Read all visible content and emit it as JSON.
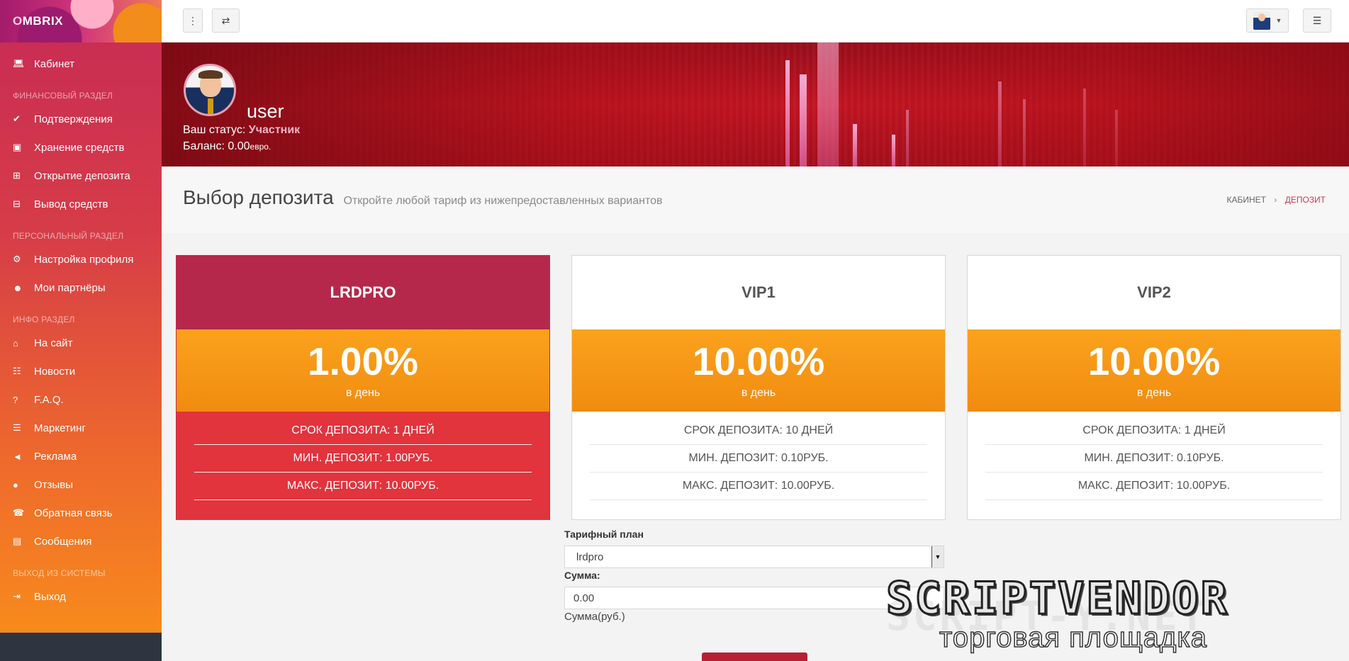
{
  "brand": {
    "first_letter": "O",
    "rest": "MBRIX"
  },
  "sidebar": {
    "cabinet": {
      "label": "Кабинет",
      "icon": "laptop-icon"
    },
    "sections": [
      {
        "title": "ФИНАНСОВЫЙ РАЗДЕЛ",
        "items": [
          {
            "label": "Подтверждения",
            "icon": "check-circle-icon"
          },
          {
            "label": "Хранение средств",
            "icon": "briefcase-icon"
          },
          {
            "label": "Открытие депозита",
            "icon": "plus-square-icon"
          },
          {
            "label": "Вывод средств",
            "icon": "minus-square-icon"
          }
        ]
      },
      {
        "title": "ПЕРСОНАЛЬНЫЙ РАЗДЕЛ",
        "items": [
          {
            "label": "Настройка профиля",
            "icon": "gears-icon"
          },
          {
            "label": "Мои партнёры",
            "icon": "users-icon"
          }
        ]
      },
      {
        "title": "ИНФО РАЗДЕЛ",
        "items": [
          {
            "label": "На сайт",
            "icon": "home-icon"
          },
          {
            "label": "Новости",
            "icon": "newspaper-icon"
          },
          {
            "label": "F.A.Q.",
            "icon": "question-circle-icon"
          },
          {
            "label": "Маркетинг",
            "icon": "book-icon"
          },
          {
            "label": "Реклама",
            "icon": "bullhorn-icon"
          },
          {
            "label": "Отзывы",
            "icon": "comment-icon"
          },
          {
            "label": "Обратная связь",
            "icon": "phone-icon"
          },
          {
            "label": "Сообщения",
            "icon": "inbox-icon"
          }
        ]
      },
      {
        "title": "ВЫХОД ИЗ СИСТЕМЫ",
        "items": [
          {
            "label": "Выход",
            "icon": "sign-out-icon"
          }
        ]
      }
    ]
  },
  "profile": {
    "username": "user",
    "status_label": "Ваш статус:",
    "status_value": "Участник",
    "balance_label": "Баланс:",
    "balance_value": "0.00",
    "balance_unit": "евро."
  },
  "page": {
    "title": "Выбор депозита",
    "subtitle": "Откройте любой тариф из нижепредоставленных вариантов",
    "breadcrumb": [
      "КАБИНЕТ",
      "ДЕПОЗИТ"
    ]
  },
  "plans": [
    {
      "name": "LRDPRO",
      "rate": "1.00%",
      "per": "в день",
      "rows": [
        "СРОК ДЕПОЗИТА: 1 ДНЕЙ",
        "МИН. ДЕПОЗИТ: 1.00РУБ.",
        "МАКС. ДЕПОЗИТ: 10.00РУБ."
      ]
    },
    {
      "name": "VIP1",
      "rate": "10.00%",
      "per": "в день",
      "rows": [
        "СРОК ДЕПОЗИТА: 10 ДНЕЙ",
        "МИН. ДЕПОЗИТ: 0.10РУБ.",
        "МАКС. ДЕПОЗИТ: 10.00РУБ."
      ]
    },
    {
      "name": "VIP2",
      "rate": "10.00%",
      "per": "в день",
      "rows": [
        "СРОК ДЕПОЗИТА: 1 ДНЕЙ",
        "МИН. ДЕПОЗИТ: 0.10РУБ.",
        "МАКС. ДЕПОЗИТ: 10.00РУБ."
      ]
    }
  ],
  "form": {
    "plan_label": "Тарифный план",
    "plan_value": "lrdpro",
    "amount_label": "Сумма:",
    "amount_value": "0.00",
    "amount_help": "Сумма(руб.)"
  },
  "watermark": {
    "main": "SCRIPTVENDOR",
    "ghost": "SCRIPT-Y.NET",
    "sub": "торговая площадка"
  },
  "colors": {
    "accent": "#b5284b",
    "rate_band": "#f79a18",
    "active_info": "#e1343d",
    "breadcrumb_active": "#c9385a"
  }
}
